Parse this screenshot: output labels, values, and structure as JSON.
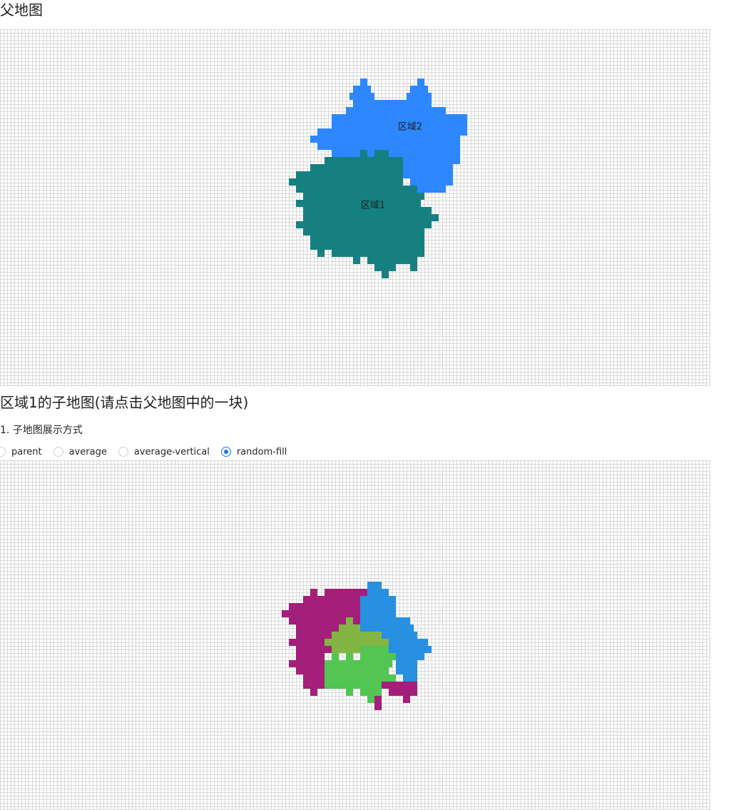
{
  "parent_section": {
    "title": "父地图"
  },
  "parent_map": {
    "regions": [
      {
        "label": "区域2",
        "color": "#2d87ff"
      },
      {
        "label": "区域1",
        "color": "#168080"
      }
    ]
  },
  "child_section": {
    "title": "区域1的子地图(请点击父地图中的一块)",
    "mode_label": "1. 子地图展示方式",
    "mode_options": [
      {
        "label": "parent",
        "checked": false
      },
      {
        "label": "average",
        "checked": false
      },
      {
        "label": "average-vertical",
        "checked": false
      },
      {
        "label": "random-fill",
        "checked": true
      }
    ]
  },
  "child_map": {
    "colors": {
      "magenta": "#a31f7a",
      "blue": "#2890e0",
      "olive": "#83b544",
      "green": "#52c552"
    }
  }
}
